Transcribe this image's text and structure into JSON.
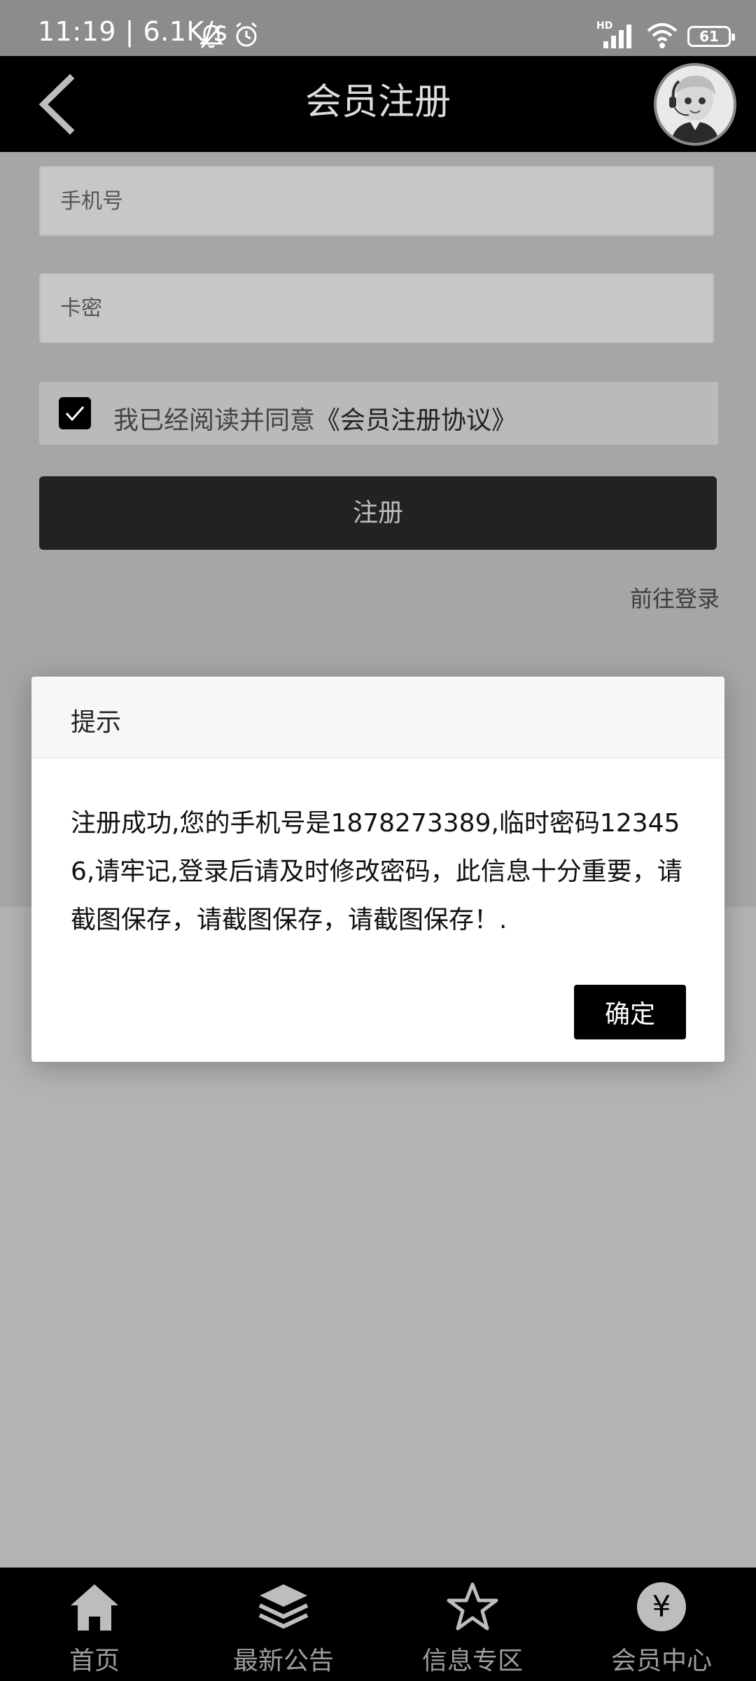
{
  "status_bar": {
    "time": "11:19 | 6.1K/s",
    "network_type": "HD",
    "battery": "61"
  },
  "header": {
    "title": "会员注册"
  },
  "form": {
    "phone_placeholder": "手机号",
    "card_key_placeholder": "卡密",
    "agree_text": "我已经阅读并同意",
    "agreement_link": "《会员注册协议》",
    "register_button": "注册",
    "goto_login": "前往登录"
  },
  "dialog": {
    "title": "提示",
    "message": "注册成功,您的手机号是1878273389,临时密码123456,请牢记,登录后请及时修改密码，此信息十分重要，请截图保存，请截图保存，请截图保存！.",
    "confirm_button": "确定"
  },
  "bottom_nav": {
    "items": [
      {
        "label": "首页",
        "icon": "home-icon"
      },
      {
        "label": "最新公告",
        "icon": "layers-icon"
      },
      {
        "label": "信息专区",
        "icon": "star-icon"
      },
      {
        "label": "会员中心",
        "icon": "yen-icon"
      }
    ]
  },
  "colors": {
    "header_bg": "#000000",
    "overlay_bg": "#b3b3b3",
    "confirm_button_bg": "#000000"
  }
}
